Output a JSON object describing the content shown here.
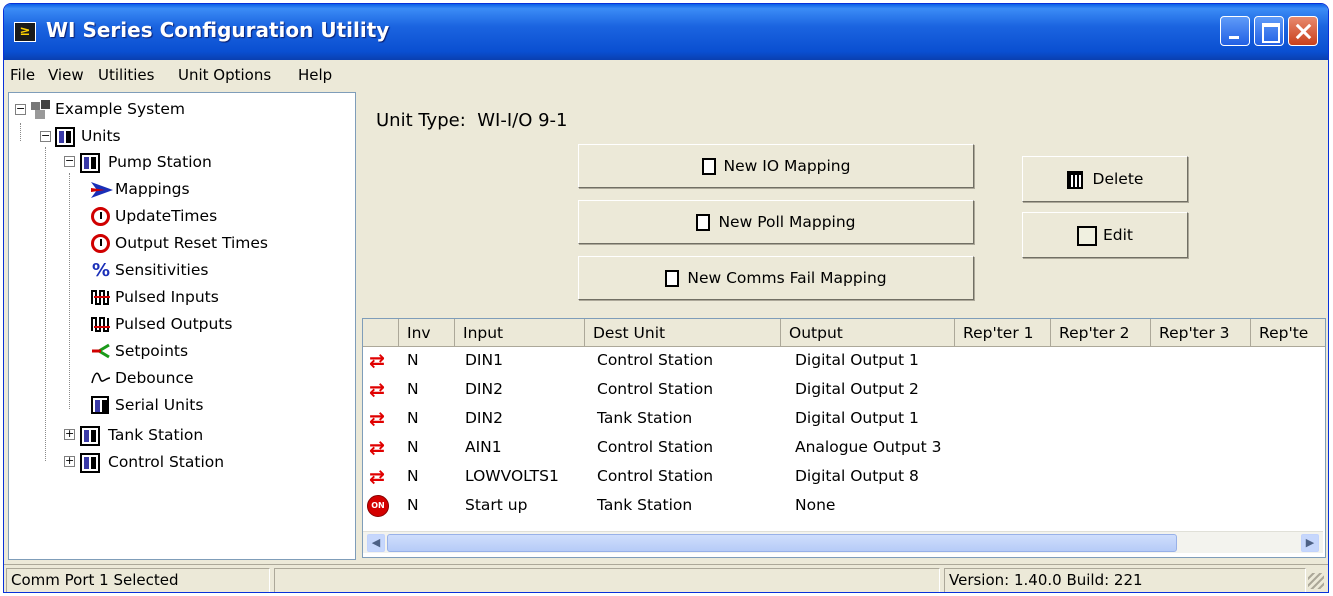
{
  "window": {
    "title": "WI Series Configuration Utility",
    "app_icon": "WI-logo-icon"
  },
  "menu": [
    {
      "label": "File"
    },
    {
      "label": "View"
    },
    {
      "label": "Utilities"
    },
    {
      "label": "Unit Options"
    },
    {
      "label": "Help"
    }
  ],
  "tree": {
    "root": "Example System",
    "units": "Units",
    "pump_station": "Pump Station",
    "children": [
      "Mappings",
      "UpdateTimes",
      "Output Reset Times",
      "Sensitivities",
      "Pulsed Inputs",
      "Pulsed Outputs",
      "Setpoints",
      "Debounce",
      "Serial Units"
    ],
    "tank_station": "Tank Station",
    "control_station": "Control Station"
  },
  "main": {
    "unit_type_label": "Unit Type:",
    "unit_type_value": "WI-I/O 9-1",
    "buttons": {
      "new_io": "New IO Mapping",
      "new_poll": "New Poll Mapping",
      "new_comms": "New Comms Fail Mapping",
      "delete": "Delete",
      "edit": "Edit"
    }
  },
  "grid": {
    "columns": [
      "",
      "Inv",
      "Input",
      "Dest Unit",
      "Output",
      "Rep'ter 1",
      "Rep'ter 2",
      "Rep'ter 3",
      "Rep'te"
    ],
    "rows": [
      {
        "icon": "mapping-arrows-icon",
        "inv": "N",
        "input": "DIN1",
        "dest": "Control Station",
        "output": "Digital Output 1"
      },
      {
        "icon": "mapping-arrows-icon",
        "inv": "N",
        "input": "DIN2",
        "dest": "Control Station",
        "output": "Digital Output 2"
      },
      {
        "icon": "mapping-arrows-icon",
        "inv": "N",
        "input": "DIN2",
        "dest": "Tank Station",
        "output": "Digital Output 1"
      },
      {
        "icon": "mapping-arrows-icon",
        "inv": "N",
        "input": "AIN1",
        "dest": "Control Station",
        "output": "Analogue Output 3"
      },
      {
        "icon": "mapping-arrows-icon",
        "inv": "N",
        "input": "LOWVOLTS1",
        "dest": "Control Station",
        "output": "Digital Output 8"
      },
      {
        "icon": "on-icon",
        "icon_text": "ON",
        "inv": "N",
        "input": "Start up",
        "dest": "Tank Station",
        "output": "None"
      }
    ]
  },
  "status": {
    "left": "Comm Port 1 Selected",
    "version": "Version: 1.40.0 Build: 221"
  },
  "colors": {
    "title_bar": "#0a4fd1",
    "accent_red": "#e00000",
    "face": "#ece9d8"
  }
}
